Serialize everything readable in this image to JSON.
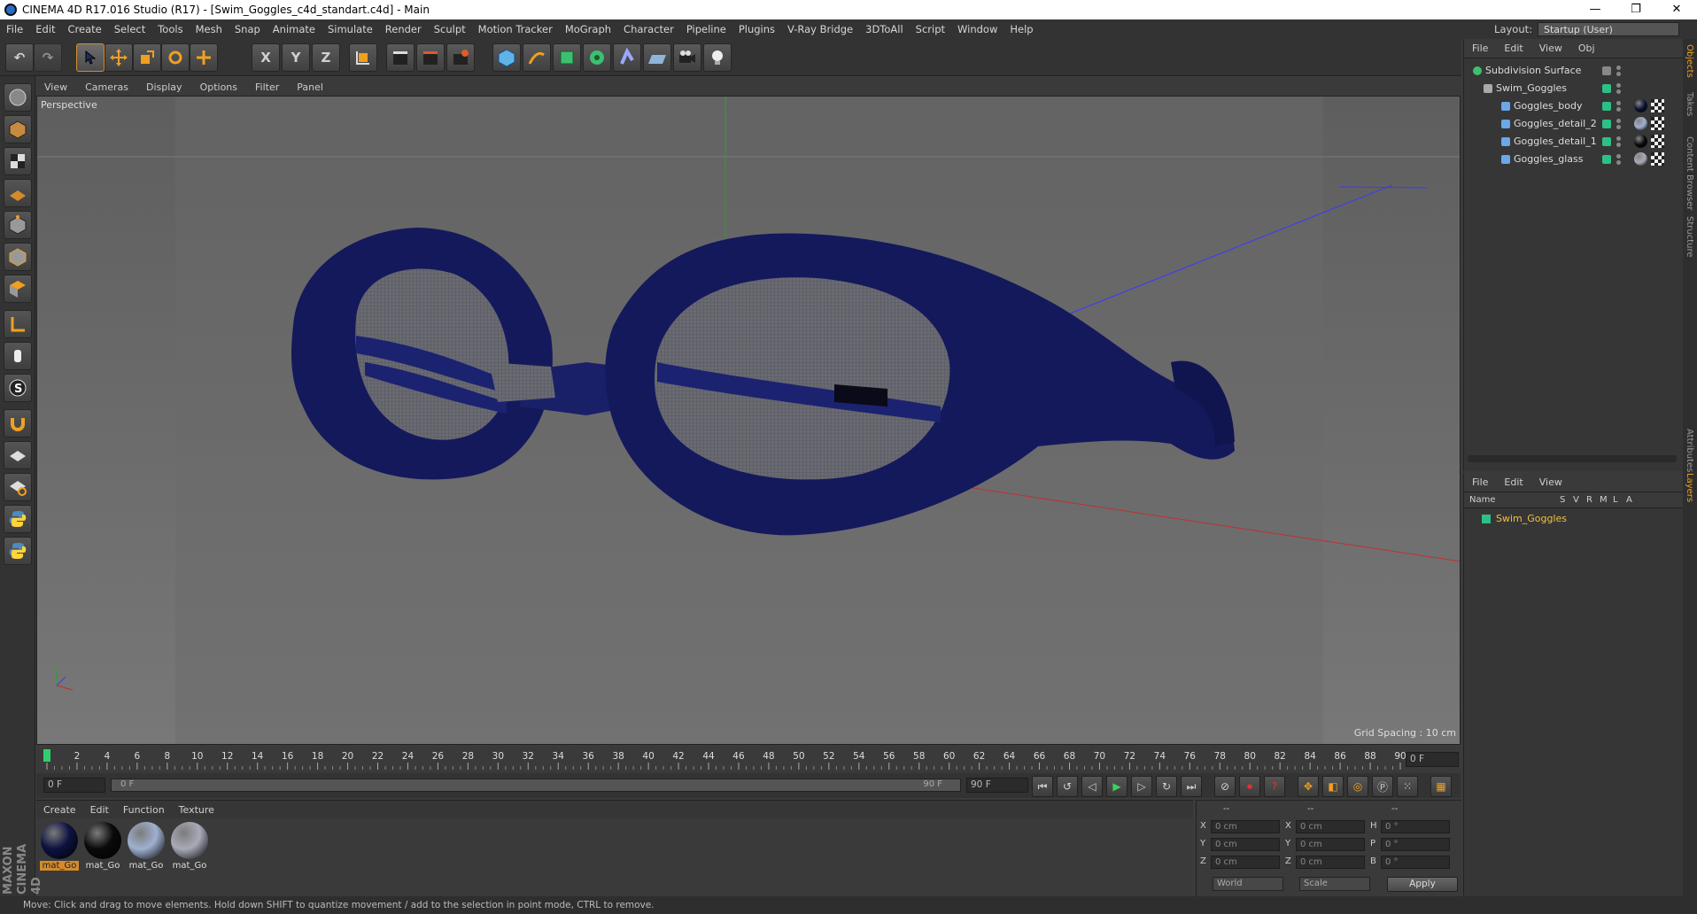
{
  "window": {
    "title": "CINEMA 4D R17.016 Studio (R17) - [Swim_Goggles_c4d_standart.c4d] - Main",
    "minimize": "—",
    "maximize": "❐",
    "close": "✕"
  },
  "menubar": {
    "items": [
      "File",
      "Edit",
      "Create",
      "Select",
      "Tools",
      "Mesh",
      "Snap",
      "Animate",
      "Simulate",
      "Render",
      "Sculpt",
      "Motion Tracker",
      "MoGraph",
      "Character",
      "Pipeline",
      "Plugins",
      "V-Ray Bridge",
      "3DToAll",
      "Script",
      "Window",
      "Help"
    ],
    "layout_label": "Layout:",
    "layout_value": "Startup (User)"
  },
  "toolbar": {
    "undo_icon": "↶",
    "redo_icon": "↷",
    "axis_x": "X",
    "axis_y": "Y",
    "axis_z": "Z"
  },
  "viewport": {
    "menu": [
      "View",
      "Cameras",
      "Display",
      "Options",
      "Filter",
      "Panel"
    ],
    "label": "Perspective",
    "grid_spacing": "Grid Spacing : 10 cm"
  },
  "timeline": {
    "ticks": [
      "0",
      "2",
      "4",
      "6",
      "8",
      "10",
      "12",
      "14",
      "16",
      "18",
      "20",
      "22",
      "24",
      "26",
      "28",
      "30",
      "32",
      "34",
      "36",
      "38",
      "40",
      "42",
      "44",
      "46",
      "48",
      "50",
      "52",
      "54",
      "56",
      "58",
      "60",
      "62",
      "64",
      "66",
      "68",
      "70",
      "72",
      "74",
      "76",
      "78",
      "80",
      "82",
      "84",
      "86",
      "88",
      "90"
    ],
    "current_frame": "0 F",
    "start": "0 F",
    "range_start": "0 F",
    "range_end": "90 F",
    "end": "90 F"
  },
  "materials": {
    "menu": [
      "Create",
      "Edit",
      "Function",
      "Texture"
    ],
    "items": [
      {
        "label": "mat_Go",
        "color": "#0d1240"
      },
      {
        "label": "mat_Go",
        "color": "#0a0a0a"
      },
      {
        "label": "mat_Go",
        "color": "#9fb0d0"
      },
      {
        "label": "mat_Go",
        "color": "#a8aab8"
      }
    ]
  },
  "coords": {
    "header": [
      "--",
      "--",
      "--"
    ],
    "rows": [
      {
        "a": "X",
        "av": "0 cm",
        "b": "X",
        "bv": "0 cm",
        "c": "H",
        "cv": "0 °"
      },
      {
        "a": "Y",
        "av": "0 cm",
        "b": "Y",
        "bv": "0 cm",
        "c": "P",
        "cv": "0 °"
      },
      {
        "a": "Z",
        "av": "0 cm",
        "b": "Z",
        "bv": "0 cm",
        "c": "B",
        "cv": "0 °"
      }
    ],
    "mode1": "World",
    "mode2": "Scale",
    "apply": "Apply"
  },
  "objects": {
    "menu": [
      "File",
      "Edit",
      "View",
      "Obj"
    ],
    "tree": [
      {
        "name": "Subdivision Surface"
      },
      {
        "name": "Swim_Goggles"
      },
      {
        "name": "Goggles_body"
      },
      {
        "name": "Goggles_detail_2"
      },
      {
        "name": "Goggles_detail_1"
      },
      {
        "name": "Goggles_glass"
      }
    ]
  },
  "layers": {
    "menu": [
      "File",
      "Edit",
      "View"
    ],
    "cols": [
      "Name",
      "S",
      "V",
      "R",
      "M",
      "L",
      "A"
    ],
    "rows": [
      {
        "name": "Swim_Goggles"
      }
    ]
  },
  "sidetabs": [
    "Objects",
    "Takes",
    "Content Browser",
    "Structure",
    "Attributes",
    "Layers"
  ],
  "status": "Move: Click and drag to move elements. Hold down SHIFT to quantize movement / add to the selection in point mode, CTRL to remove.",
  "brand": "MAXON CINEMA 4D",
  "colors": {
    "accent": "#d48a2b",
    "object_green": "#2cc087",
    "layer_name": "#f0c040",
    "goggle_blue": "#101a5c"
  }
}
